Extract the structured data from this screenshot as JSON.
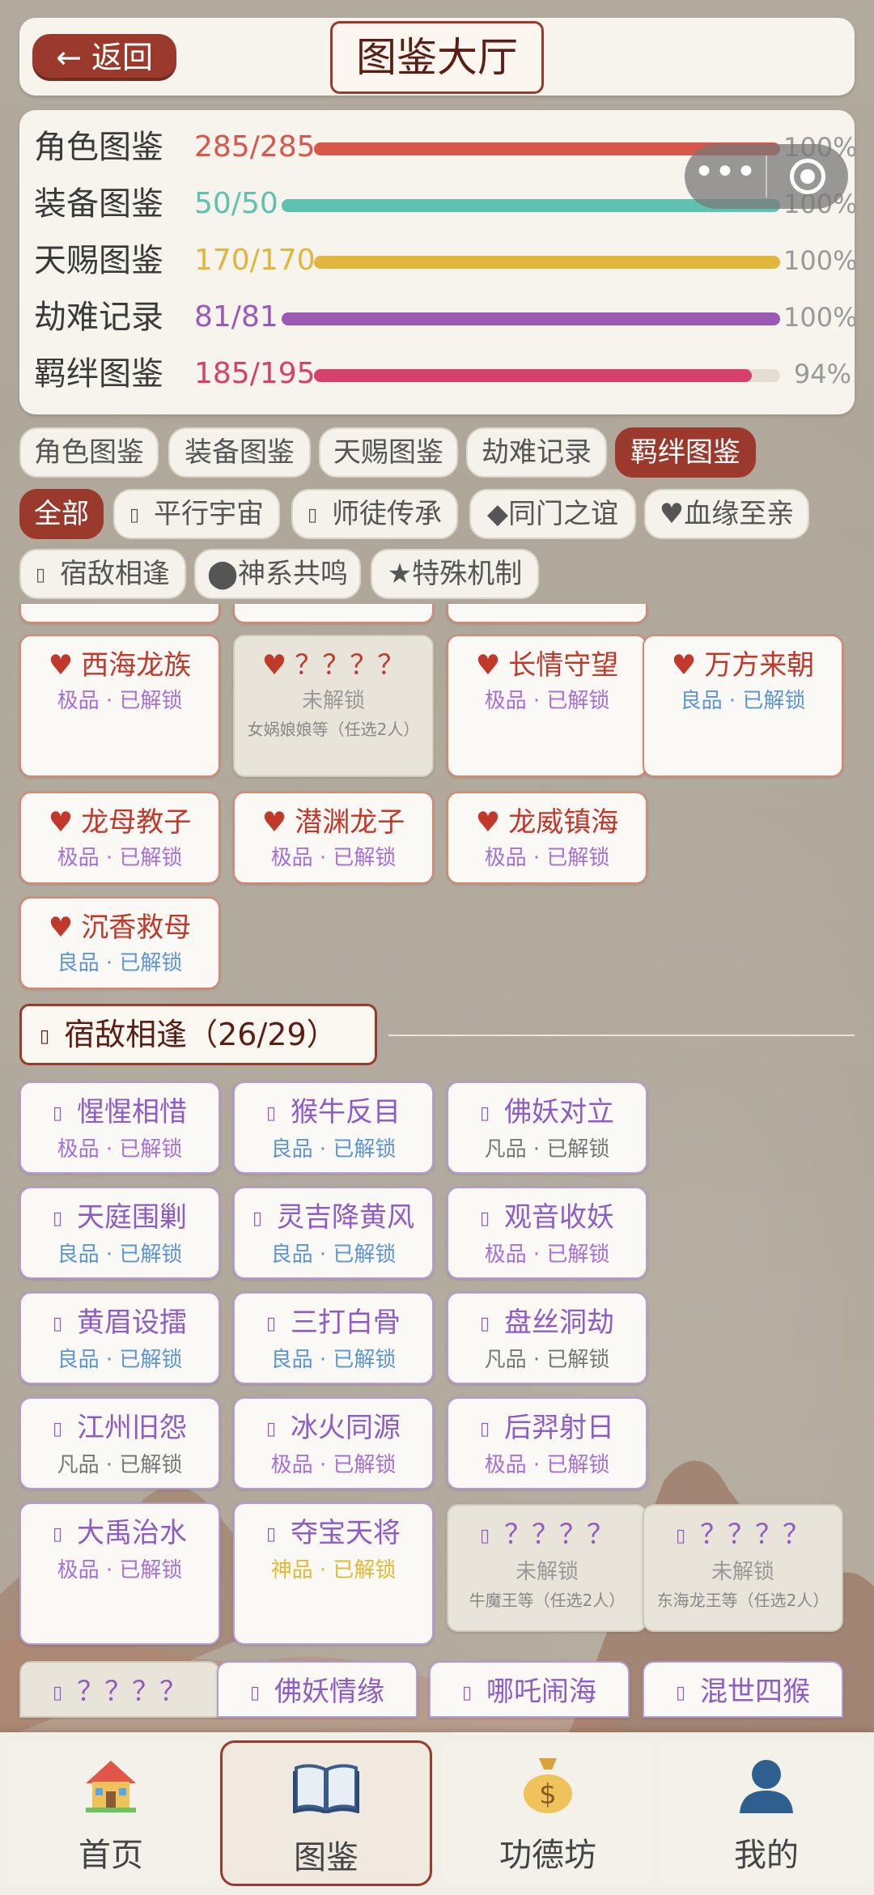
{
  "header": {
    "back_label": "← 返回",
    "title": "图鉴大厅"
  },
  "stats": [
    {
      "label": "角色图鉴",
      "count": "285/285",
      "pct": "100%",
      "fill": 1.0,
      "color": "#d9574a"
    },
    {
      "label": "装备图鉴",
      "count": "50/50",
      "pct": "100%",
      "fill": 1.0,
      "color": "#5dc2b0"
    },
    {
      "label": "天赐图鉴",
      "count": "170/170",
      "pct": "100%",
      "fill": 1.0,
      "color": "#e2b53c"
    },
    {
      "label": "劫难记录",
      "count": "81/81",
      "pct": "100%",
      "fill": 1.0,
      "color": "#9b59b6"
    },
    {
      "label": "羁绊图鉴",
      "count": "185/195",
      "pct": "94%",
      "fill": 0.94,
      "color": "#d6406a"
    }
  ],
  "category_tabs": [
    "角色图鉴",
    "装备图鉴",
    "天赐图鉴",
    "劫难记录",
    "羁绊图鉴"
  ],
  "filters": [
    "全部",
    "平行宇宙",
    "师徒传承",
    "◆同门之谊",
    "♥血缘至亲",
    "宿敌相逢",
    "⬤神系共鸣",
    "★特殊机制"
  ],
  "heart_cards": [
    {
      "name": "西海龙族",
      "grade": "极品",
      "status": "已解锁"
    },
    {
      "name": "？？？？",
      "grade": "",
      "status": "未解锁",
      "hint": "女娲娘娘等（任选2人）"
    },
    {
      "name": "长情守望",
      "grade": "极品",
      "status": "已解锁"
    },
    {
      "name": "万方来朝",
      "grade": "良品",
      "status": "已解锁"
    },
    {
      "name": "龙母教子",
      "grade": "极品",
      "status": "已解锁"
    },
    {
      "name": "潜渊龙子",
      "grade": "极品",
      "status": "已解锁"
    },
    {
      "name": "龙威镇海",
      "grade": "极品",
      "status": "已解锁"
    },
    {
      "name": "沉香救母",
      "grade": "良品",
      "status": "已解锁"
    }
  ],
  "section": {
    "title": "宿敌相逢（26/29）"
  },
  "rival_cards": [
    {
      "name": "惺惺相惜",
      "grade": "极品",
      "status": "已解锁"
    },
    {
      "name": "猴牛反目",
      "grade": "良品",
      "status": "已解锁"
    },
    {
      "name": "佛妖对立",
      "grade": "凡品",
      "status": "已解锁"
    },
    {
      "name": "天庭围剿",
      "grade": "良品",
      "status": "已解锁"
    },
    {
      "name": "灵吉降黄风",
      "grade": "良品",
      "status": "已解锁"
    },
    {
      "name": "观音收妖",
      "grade": "极品",
      "status": "已解锁"
    },
    {
      "name": "黄眉设擂",
      "grade": "良品",
      "status": "已解锁"
    },
    {
      "name": "三打白骨",
      "grade": "良品",
      "status": "已解锁"
    },
    {
      "name": "盘丝洞劫",
      "grade": "凡品",
      "status": "已解锁"
    },
    {
      "name": "江州旧怨",
      "grade": "凡品",
      "status": "已解锁"
    },
    {
      "name": "冰火同源",
      "grade": "极品",
      "status": "已解锁"
    },
    {
      "name": "后羿射日",
      "grade": "极品",
      "status": "已解锁"
    },
    {
      "name": "大禹治水",
      "grade": "极品",
      "status": "已解锁"
    },
    {
      "name": "夺宝天将",
      "grade": "神品",
      "status": "已解锁"
    },
    {
      "name": "？？？？",
      "grade": "",
      "status": "未解锁",
      "hint": "牛魔王等（任选2人）"
    },
    {
      "name": "？？？？",
      "grade": "",
      "status": "未解锁",
      "hint": "东海龙王等（任选2人）"
    },
    {
      "name": "？？？？",
      "grade": "",
      "status": ""
    },
    {
      "name": "佛妖情缘",
      "grade": "",
      "status": ""
    },
    {
      "name": "哪吒闹海",
      "grade": "",
      "status": ""
    },
    {
      "name": "混世四猴",
      "grade": "",
      "status": ""
    }
  ],
  "grade_colors": {
    "极品": "#a86fd8",
    "良品": "#5b95d6",
    "凡品": "#777777",
    "神品": "#e5b933"
  },
  "nav": [
    {
      "label": "首页",
      "icon": "house-icon"
    },
    {
      "label": "图鉴",
      "icon": "book-icon"
    },
    {
      "label": "功德坊",
      "icon": "money-bag-icon"
    },
    {
      "label": "我的",
      "icon": "user-icon"
    }
  ]
}
